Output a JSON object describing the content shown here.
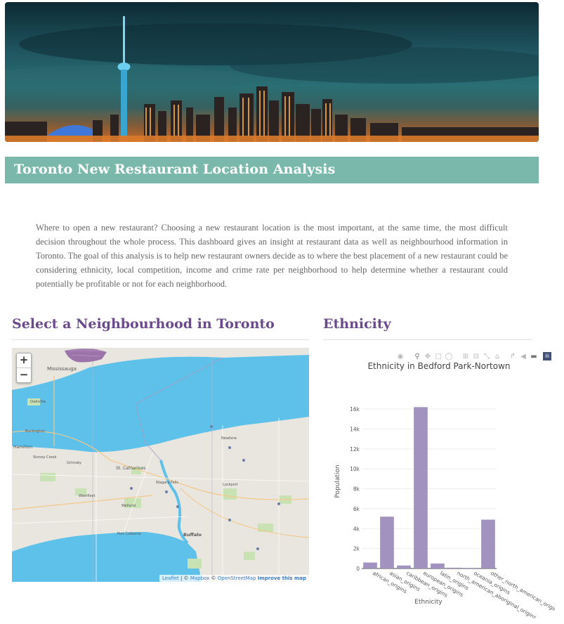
{
  "header": {
    "title": "Toronto New Restaurant Location Analysis"
  },
  "intro": {
    "text": "Where to open a new restaurant? Choosing a new restaurant location is the most important, at the same time, the most difficult decision throughout the whole process. This dashboard gives an insight at restaurant data as well as neighbourhood information in Toronto. The goal of this analysis is to help new restaurant owners decide as to where the best placement of a new restaurant could be considering ethnicity, local competition, income and crime rate per neighborhood to help determine whether a restaurant could potentially be profitable or not for each neighborhood."
  },
  "map_section": {
    "heading": "Select a Neighbourhood in Toronto",
    "zoom_in": "+",
    "zoom_out": "−",
    "attribution": {
      "leaflet": "Leaflet",
      "sep1": " | © ",
      "mapbox": "Mapbox",
      "sep2": " © ",
      "osm": "OpenStreetMap",
      "improve": "Improve this map"
    },
    "place_labels": {
      "mississauga": "Mississauga",
      "oakville": "Oakville",
      "burlington": "Burlington",
      "hamilton": "Hamilton",
      "stoney_creek": "Stoney Creek",
      "grimsby": "Grimsby",
      "st_catharines": "St. Catharines",
      "niagara_falls": "Niagara Falls",
      "buffalo": "Buffalo",
      "newfane": "Newfane",
      "lockport": "Lockport",
      "welland": "Welland",
      "wainfleet": "Wainfleet",
      "port_colborne": "Port Colborne"
    }
  },
  "ethnicity_section": {
    "heading": "Ethnicity",
    "modebar_icons": [
      "camera-icon",
      "zoom-icon",
      "pan-icon",
      "box-select-icon",
      "lasso-icon",
      "zoom-in-icon",
      "zoom-out-icon",
      "autoscale-icon",
      "home-icon",
      "spike-icon",
      "hover-closest-icon",
      "hover-compare-icon",
      "plotly-logo-icon"
    ],
    "modebar_logo": "ili"
  },
  "colors": {
    "accent_header": "#7ab8ab",
    "heading_purple": "#6b4a8c",
    "bar_fill": "#a192bf",
    "water": "#5ec1ea",
    "land": "#e9e6df"
  },
  "chart_data": {
    "type": "bar",
    "title": "Ethnicity in Bedford Park-Nortown",
    "xlabel": "Ethnicity",
    "ylabel": "Population",
    "categories": [
      "african_origins",
      "asian_origins",
      "caribbean_origins",
      "european_origins",
      "latin_origins",
      "north_american_aboriginal_origins",
      "oceania_origins",
      "other_north_american_origins"
    ],
    "values": [
      600,
      5200,
      300,
      16200,
      500,
      80,
      60,
      4900
    ],
    "ylim": [
      0,
      17000
    ],
    "yticks": [
      0,
      2000,
      4000,
      6000,
      8000,
      10000,
      12000,
      14000,
      16000
    ],
    "ytick_labels": [
      "0",
      "2k",
      "4k",
      "6k",
      "8k",
      "10k",
      "12k",
      "14k",
      "16k"
    ],
    "grid": true
  }
}
